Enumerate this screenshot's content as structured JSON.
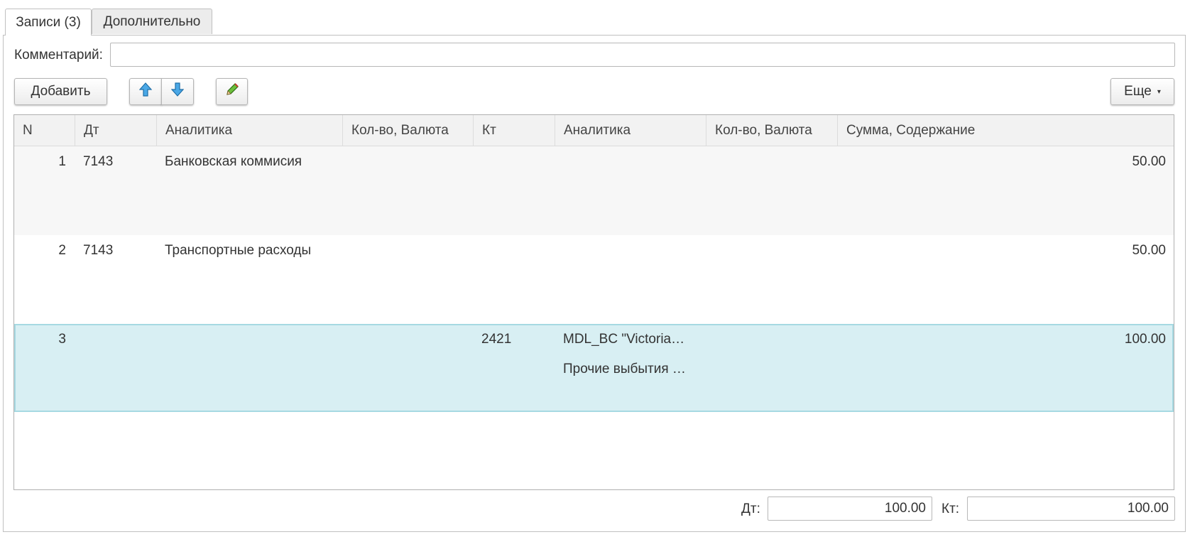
{
  "tabs": [
    {
      "label": "Записи (3)",
      "active": true
    },
    {
      "label": "Дополнительно",
      "active": false
    }
  ],
  "comment": {
    "label": "Комментарий:",
    "value": ""
  },
  "toolbar": {
    "add_label": "Добавить",
    "up_icon": "arrow-up-icon",
    "down_icon": "arrow-down-icon",
    "edit_icon": "pencil-icon",
    "more_label": "Еще"
  },
  "table": {
    "columns": [
      "N",
      "Дт",
      "Аналитика",
      "Кол-во, Валюта",
      "Кт",
      "Аналитика",
      "Кол-во, Валюта",
      "Сумма, Содержание"
    ],
    "rows": [
      {
        "n": "1",
        "dt": "7143",
        "dt_analytics": "Банковская коммисия",
        "dt_qty": "",
        "kt": "",
        "kt_analytics_1": "",
        "kt_analytics_2": "",
        "kt_qty": "",
        "sum": "50.00"
      },
      {
        "n": "2",
        "dt": "7143",
        "dt_analytics": "Транспортные расходы",
        "dt_qty": "",
        "kt": "",
        "kt_analytics_1": "",
        "kt_analytics_2": "",
        "kt_qty": "",
        "sum": "50.00"
      },
      {
        "n": "3",
        "dt": "",
        "dt_analytics": "",
        "dt_qty": "",
        "kt": "2421",
        "kt_analytics_1": "MDL_BC \"Victoria…",
        "kt_analytics_2": "Прочие выбытия …",
        "kt_qty": "",
        "sum": "100.00",
        "selected": true
      }
    ],
    "colors": {
      "header_bg": "#f2f2f2",
      "row_alt_bg": "#f7f7f7",
      "selected_bg": "#d8eff3",
      "selected_border": "#a6d9e2"
    }
  },
  "totals": {
    "dt_label": "Дт:",
    "dt_value": "100.00",
    "kt_label": "Кт:",
    "kt_value": "100.00"
  }
}
